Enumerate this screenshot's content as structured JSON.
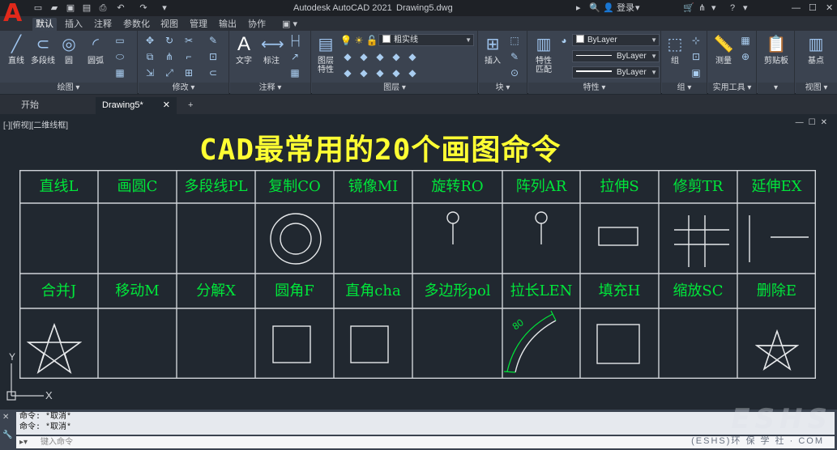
{
  "title_bar": {
    "app_title": "Autodesk AutoCAD 2021",
    "doc_name": "Drawing5.dwg",
    "login": "登录",
    "logo": "A"
  },
  "ribbon_tabs": [
    "默认",
    "插入",
    "注释",
    "参数化",
    "视图",
    "管理",
    "输出",
    "协作",
    "▣ ▾"
  ],
  "ribbon": {
    "draw": {
      "label": "绘图 ▾",
      "buttons": [
        "直线",
        "多段线",
        "圆",
        "圆弧"
      ]
    },
    "modify": {
      "label": "修改 ▾"
    },
    "annotation": {
      "label": "注释 ▾",
      "buttons": [
        "文字",
        "标注"
      ]
    },
    "layers": {
      "label": "图层 ▾",
      "layer_value": "粗实线",
      "buttons": [
        "图层\n特性"
      ]
    },
    "block": {
      "label": "块 ▾",
      "buttons": [
        "插入"
      ]
    },
    "properties": {
      "label": "特性 ▾",
      "color": "ByLayer",
      "linetype": "ByLayer",
      "lineweight": "ByLayer",
      "buttons": [
        "特性\n匹配"
      ]
    },
    "groups": {
      "label": "组 ▾",
      "buttons": [
        "组"
      ]
    },
    "utilities": {
      "label": "实用工具 ▾",
      "buttons": [
        "测量"
      ]
    },
    "clipboard": {
      "label": "▾",
      "buttons": [
        "剪贴板"
      ]
    },
    "view": {
      "label": "视图 ▾",
      "buttons": [
        "基点"
      ]
    }
  },
  "doc_tabs": [
    "开始",
    "Drawing5*"
  ],
  "viewport": {
    "label": "[-][俯视][二维线框]",
    "heading": "CAD最常用的20个画图命令"
  },
  "commands_row1": [
    "直线L",
    "画圆C",
    "多段线PL",
    "复制CO",
    "镜像MI",
    "旋转RO",
    "阵列AR",
    "拉伸S",
    "修剪TR",
    "延伸EX"
  ],
  "commands_row2": [
    "合并J",
    "移动M",
    "分解X",
    "圆角F",
    "直角cha",
    "多边形pol",
    "拉长LEN",
    "填充H",
    "缩放SC",
    "删除E"
  ],
  "arc_dimension": "80",
  "ucs": {
    "y": "Y",
    "x": "X"
  },
  "command_line": {
    "history": [
      "命令: *取消*",
      "命令: *取消*"
    ],
    "placeholder": "键入命令"
  },
  "watermark": {
    "main": "ESHS",
    "sub": "(ESHS)环 保 学 社 · COM"
  },
  "colors": {
    "heading": "#ffff33",
    "command_text": "#00e63a",
    "table_lines": "#cfd3d8",
    "canvas": "#212830",
    "logo": "#e0291b"
  }
}
